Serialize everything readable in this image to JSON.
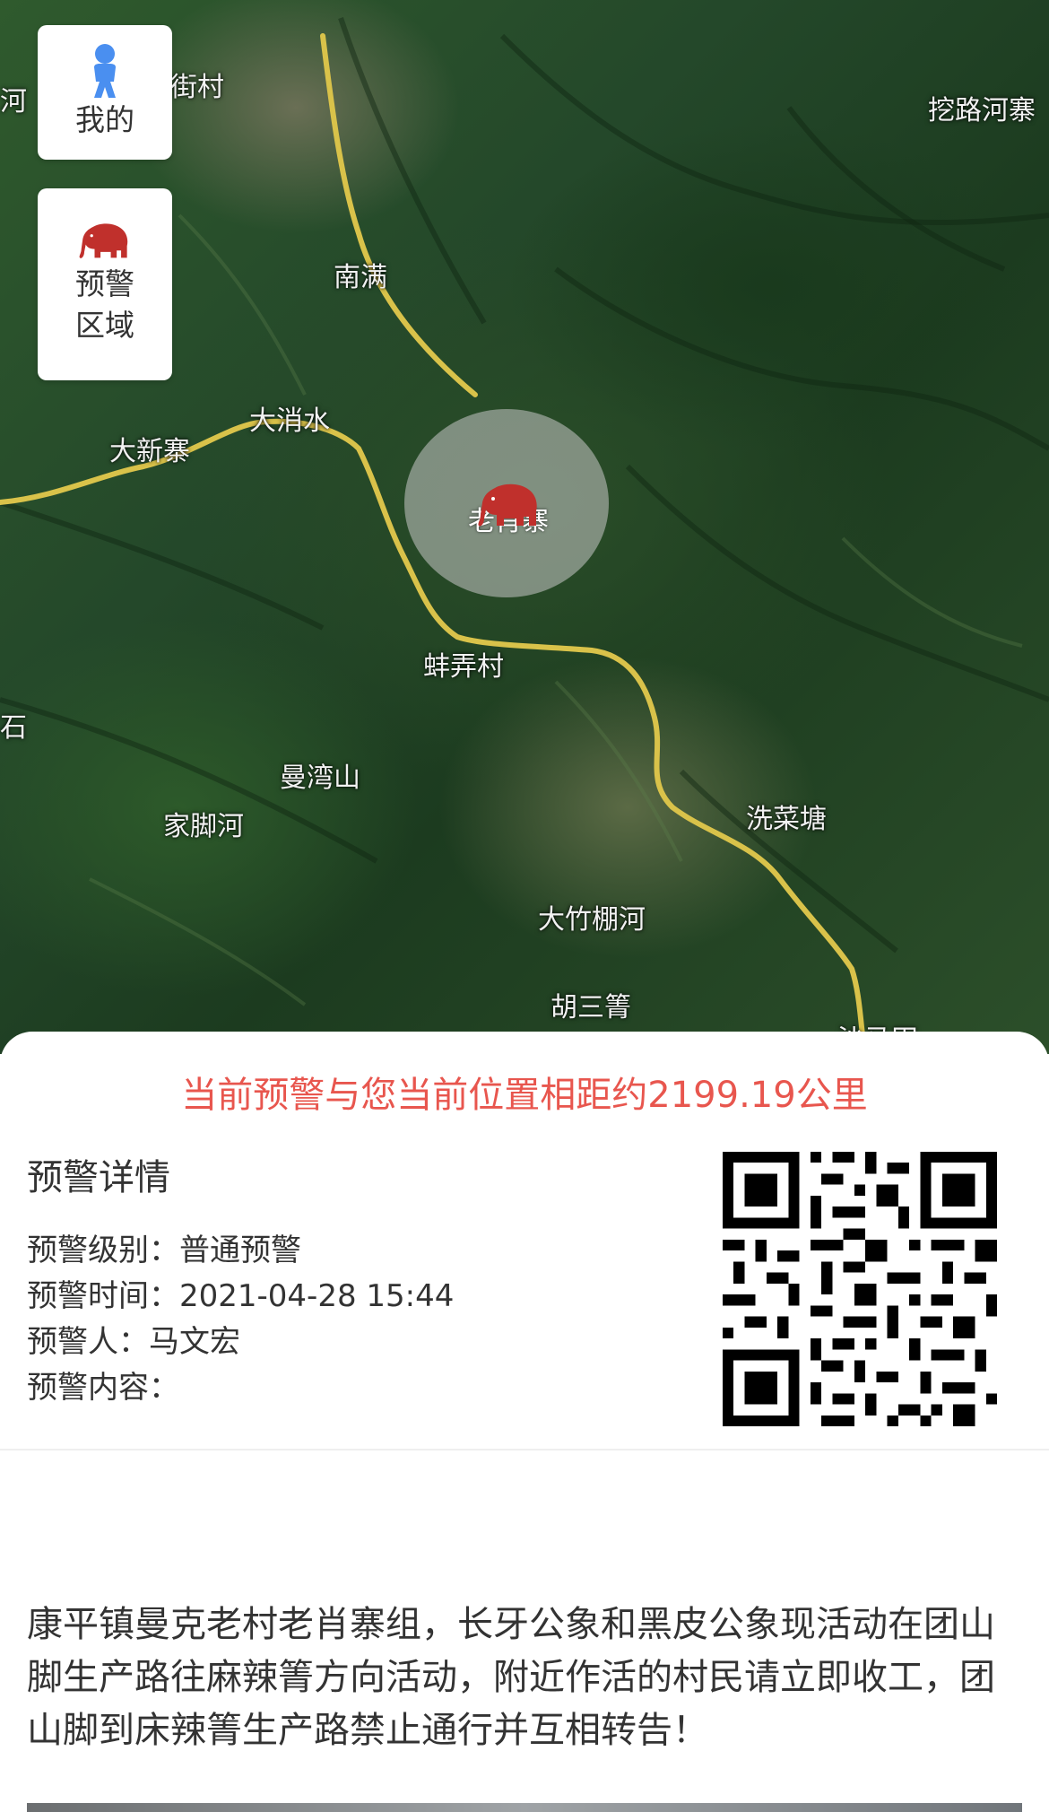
{
  "map": {
    "places": [
      {
        "label": "街村"
      },
      {
        "label": "挖路河寨"
      },
      {
        "label": "南满"
      },
      {
        "label": "大消水"
      },
      {
        "label": "大新寨"
      },
      {
        "label": "蚌弄村"
      },
      {
        "label": "曼湾山"
      },
      {
        "label": "家脚河"
      },
      {
        "label": "洗菜塘"
      },
      {
        "label": "大竹棚河"
      },
      {
        "label": "胡三箐"
      },
      {
        "label": "沙马田"
      },
      {
        "label": "河"
      },
      {
        "label": "石"
      }
    ],
    "circle_label": "老肖寨",
    "circle_icon": "elephant-icon"
  },
  "buttons": {
    "mine_label": "我的",
    "mine_icon": "person-icon",
    "zone_label_line1": "预警",
    "zone_label_line2": "区域",
    "zone_icon": "elephant-icon"
  },
  "panel": {
    "distance_text": "当前预警与您当前位置相距约2199.19公里",
    "details_title": "预警详情",
    "level": "预警级别：普通预警",
    "time": "预警时间：2021-04-28 15:44",
    "person": "预警人：马文宏",
    "content_label": "预警内容：",
    "message": "康平镇曼克老村老肖寨组，长牙公象和黑皮公象现活动在团山脚生产路往麻辣箐方向活动，附近作活的村民请立即收工，团山脚到床辣箐生产路禁止通行并互相转告！"
  },
  "colors": {
    "accent_red": "#e8564e",
    "elephant_red": "#c0302c",
    "person_blue": "#4a8ff0",
    "road_yellow": "#d9c24a"
  }
}
